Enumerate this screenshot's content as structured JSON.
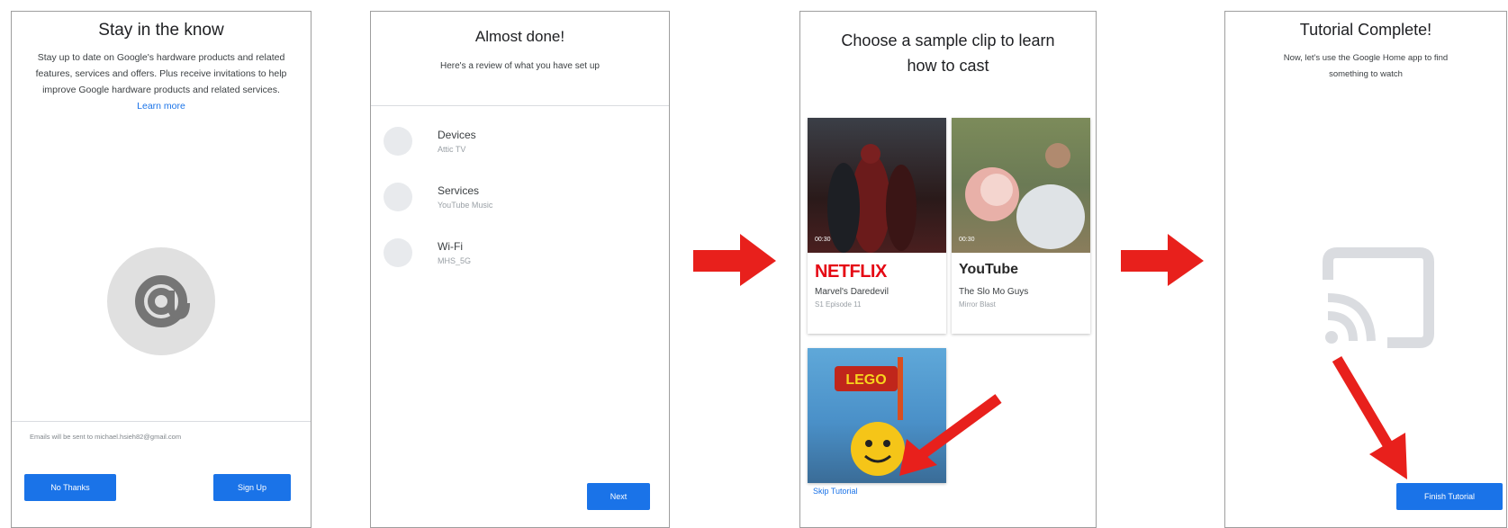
{
  "screen1": {
    "title": "Stay in the know",
    "body": "Stay up to date on Google's hardware products and related features, services and offers. Plus receive invitations to help improve Google hardware products and related services.",
    "learn_more": "Learn more",
    "email_note": "Emails will be sent to michael.hsieh82@gmail.com",
    "no_thanks": "No Thanks",
    "sign_up": "Sign Up",
    "icon": "at-sign-icon"
  },
  "screen2": {
    "title": "Almost done!",
    "subtitle": "Here's a review of what you have set up",
    "items": [
      {
        "label": "Devices",
        "value": "Attic TV"
      },
      {
        "label": "Services",
        "value": "YouTube Music"
      },
      {
        "label": "Wi-Fi",
        "value": "MHS_5G"
      }
    ],
    "next": "Next"
  },
  "screen3": {
    "title_line1": "Choose a sample clip to learn",
    "title_line2": "how to cast",
    "clips": [
      {
        "brand": "NETFLIX",
        "title": "Marvel's Daredevil",
        "sub": "S1 Episode 11",
        "duration": "00:30"
      },
      {
        "brand": "YouTube",
        "title": "The Slo Mo Guys",
        "sub": "Mirror Blast",
        "duration": "00:30"
      },
      {
        "brand": "LEGO",
        "title": "",
        "sub": "",
        "duration": ""
      }
    ],
    "skip": "Skip Tutorial"
  },
  "screen4": {
    "title": "Tutorial Complete!",
    "body_line1": "Now, let's use the Google Home app to find",
    "body_line2": "something to watch",
    "finish": "Finish Tutorial",
    "icon": "cast-icon"
  },
  "colors": {
    "accent": "#1a73e8",
    "arrow": "#e8201c",
    "netflix": "#e50914",
    "youtube": "#e62117"
  }
}
